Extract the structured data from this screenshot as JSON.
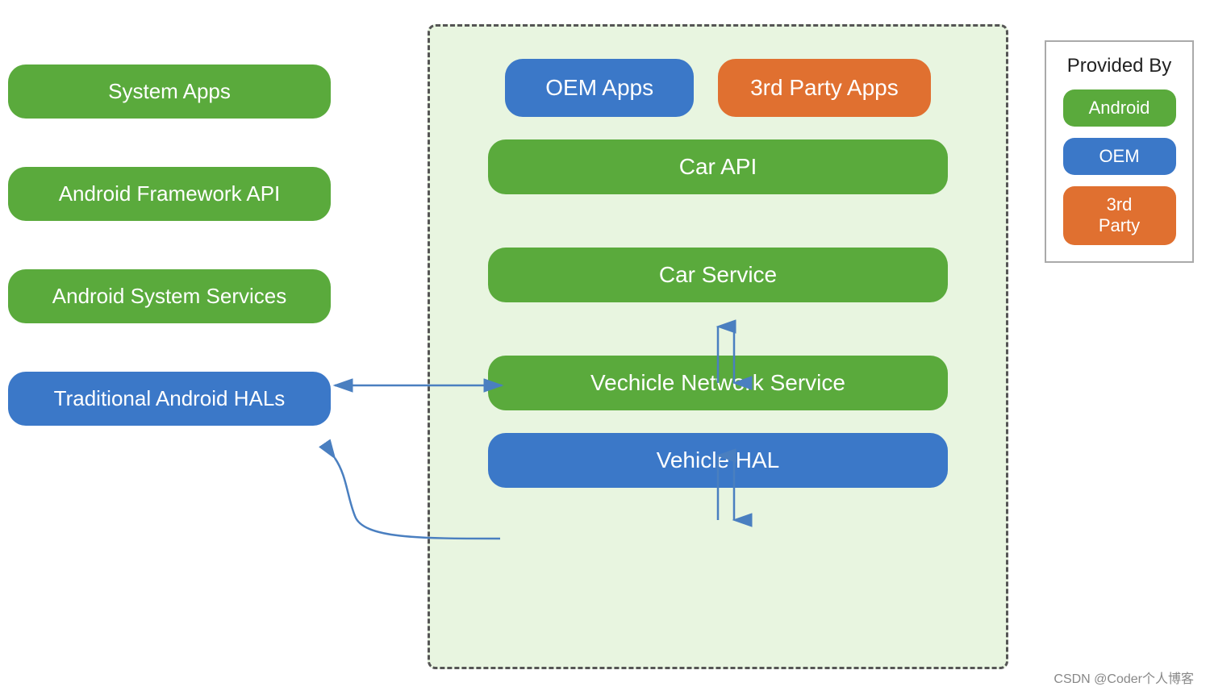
{
  "left": {
    "system_apps": "System Apps",
    "android_framework_api": "Android Framework API",
    "android_system_services": "Android System Services",
    "traditional_android_hals": "Traditional Android HALs"
  },
  "inner": {
    "oem_apps": "OEM Apps",
    "third_party_apps": "3rd Party Apps",
    "car_api": "Car API",
    "car_service": "Car Service",
    "vehicle_network_service": "Vechicle Network Service",
    "vehicle_hal": "Vehicle HAL"
  },
  "legend": {
    "title": "Provided By",
    "android": "Android",
    "oem": "OEM",
    "third_party_line1": "3rd",
    "third_party_line2": "Party"
  },
  "watermark": "CSDN @Coder个人博客"
}
